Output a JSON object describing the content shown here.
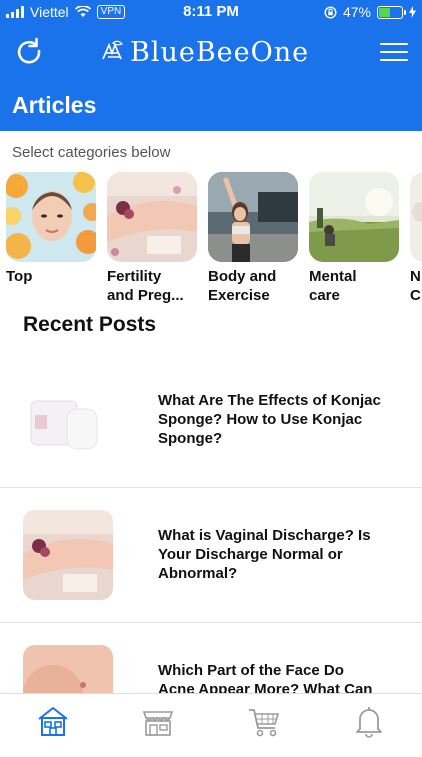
{
  "status": {
    "carrier": "Viettel",
    "vpn": "VPN",
    "time": "8:11 PM",
    "battery": "47%",
    "battery_level": 0.47
  },
  "header": {
    "brand": "BlueBeeOne",
    "title": "Articles"
  },
  "categories": {
    "prompt": "Select categories below",
    "items": [
      {
        "label_line1": "Top",
        "label_line2": ""
      },
      {
        "label_line1": "Fertility",
        "label_line2": "and Preg..."
      },
      {
        "label_line1": "Body and",
        "label_line2": "Exercise"
      },
      {
        "label_line1": "Mental",
        "label_line2": "care"
      },
      {
        "label_line1": "N",
        "label_line2": "C"
      }
    ]
  },
  "recent": {
    "heading": "Recent Posts",
    "posts": [
      {
        "line1": "What Are The Effects of Konjac",
        "line2": "Sponge? How to Use Konjac",
        "line3": "Sponge?"
      },
      {
        "line1": "What is Vaginal Discharge? Is",
        "line2": "Your Discharge Normal or",
        "line3": "Abnormal?"
      },
      {
        "line1": "Which Part of the Face Do",
        "line2": "Acne Appear More? What  Can",
        "line3": ""
      }
    ]
  },
  "colors": {
    "primary": "#1a73ea",
    "active_tab": "#1a73ea",
    "inactive_tab": "#9b9b9b"
  },
  "tabs": [
    {
      "icon": "home-icon",
      "active": true
    },
    {
      "icon": "store-icon",
      "active": false
    },
    {
      "icon": "cart-icon",
      "active": false
    },
    {
      "icon": "bell-icon",
      "active": false
    }
  ]
}
